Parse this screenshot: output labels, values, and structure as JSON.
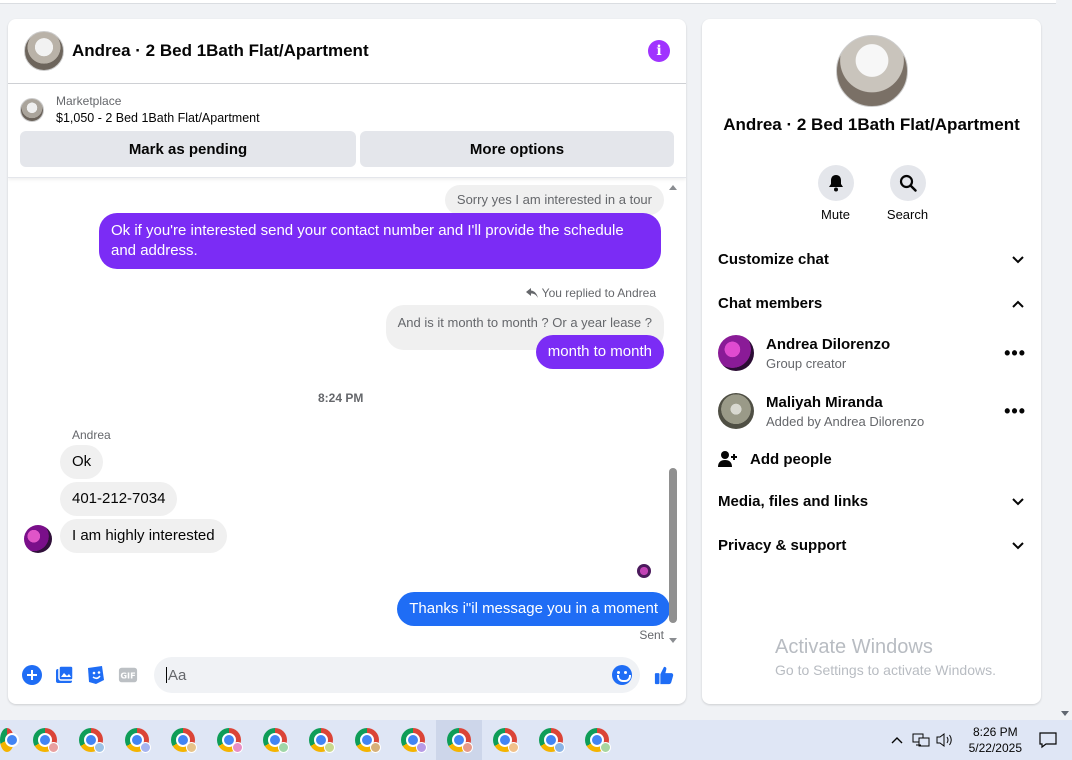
{
  "chat": {
    "title": "Andrea · 2 Bed 1Bath Flat/Apartment",
    "listing": {
      "label": "Marketplace",
      "price_title": "$1,050 - 2 Bed 1Bath Flat/Apartment",
      "mark_pending": "Mark as pending",
      "more_options": "More options"
    },
    "messages": {
      "m1": "Sorry yes I am interested in a tour",
      "m2": "Ok if you're interested send your contact number and I'll provide the schedule and address.",
      "reply_meta": "You replied to Andrea",
      "m3_quote": "And is it month to month ? Or a year lease ?",
      "m4": "month to month",
      "time": "8:24 PM",
      "sender": "Andrea",
      "m5": "Ok",
      "m6": "401-212-7034",
      "m7": "I am highly interested",
      "m8": "Thanks i\"il message you in a moment",
      "status": "Sent"
    },
    "composer": {
      "placeholder": "Aa"
    }
  },
  "side": {
    "title": "Andrea · 2 Bed 1Bath Flat/Apartment",
    "mute": "Mute",
    "search": "Search",
    "customize": "Customize chat",
    "members_header": "Chat members",
    "members": [
      {
        "name": "Andrea Dilorenzo",
        "sub": "Group creator"
      },
      {
        "name": "Maliyah Miranda",
        "sub": "Added by Andrea Dilorenzo"
      }
    ],
    "add_people": "Add people",
    "media": "Media, files and links",
    "privacy": "Privacy & support"
  },
  "watermark": {
    "line1": "Activate Windows",
    "line2": "Go to Settings to activate Windows."
  },
  "taskbar": {
    "time": "8:26 PM",
    "date": "5/22/2025"
  },
  "colors": {
    "purple": "#7b2cf5",
    "blue": "#1f6df5",
    "accent": "#0866ff"
  }
}
